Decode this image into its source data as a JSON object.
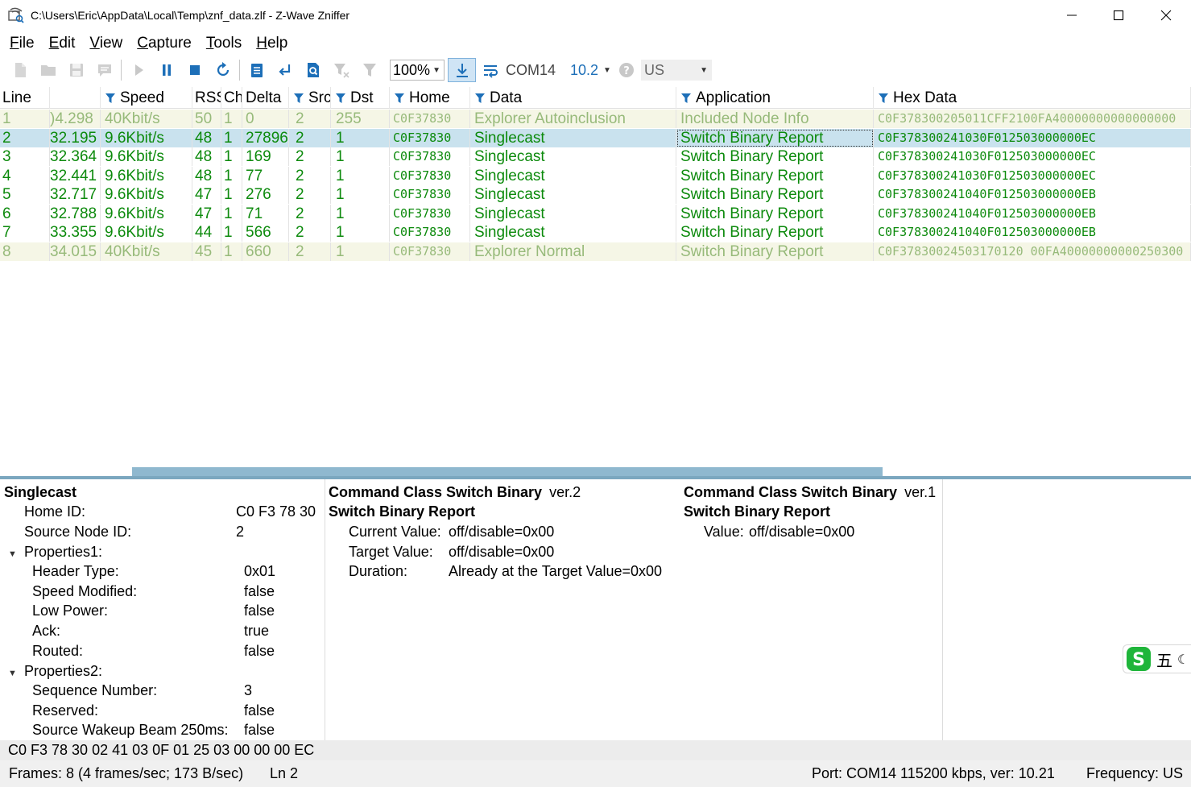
{
  "window": {
    "title": "C:\\Users\\Eric\\AppData\\Local\\Temp\\znf_data.zlf - Z-Wave Zniffer"
  },
  "menu": [
    {
      "label": "File",
      "mnemonic": "F",
      "rest": "ile"
    },
    {
      "label": "Edit",
      "mnemonic": "E",
      "rest": "dit"
    },
    {
      "label": "View",
      "mnemonic": "V",
      "rest": "iew"
    },
    {
      "label": "Capture",
      "mnemonic": "C",
      "rest": "apture"
    },
    {
      "label": "Tools",
      "mnemonic": "T",
      "rest": "ools"
    },
    {
      "label": "Help",
      "mnemonic": "H",
      "rest": "elp"
    }
  ],
  "toolbar": {
    "zoom_value": "100%",
    "port_label": "COM14",
    "version_value": "10.2",
    "frequency_value": "US",
    "icons": [
      "new-file-icon",
      "open-folder-icon",
      "save-icon",
      "comment-icon",
      "play-icon",
      "pause-icon",
      "stop-icon",
      "refresh-icon",
      "list-icon",
      "return-icon",
      "search-document-icon",
      "clear-filter-icon",
      "filter-icon",
      "download-icon",
      "wrap-icon",
      "help-icon"
    ]
  },
  "grid": {
    "columns": [
      {
        "key": "line",
        "label": "Line",
        "filter": false
      },
      {
        "key": "time",
        "label": "",
        "filter": false
      },
      {
        "key": "speed",
        "label": "Speed",
        "filter": true
      },
      {
        "key": "rssi",
        "label": "RSS",
        "filter": false
      },
      {
        "key": "ch",
        "label": "Ch",
        "filter": false
      },
      {
        "key": "delta",
        "label": "Delta",
        "filter": false
      },
      {
        "key": "src",
        "label": "Src",
        "filter": true
      },
      {
        "key": "dst",
        "label": "Dst",
        "filter": true
      },
      {
        "key": "home",
        "label": "Home",
        "filter": true
      },
      {
        "key": "data",
        "label": "Data",
        "filter": true
      },
      {
        "key": "application",
        "label": "Application",
        "filter": true
      },
      {
        "key": "hex",
        "label": "Hex Data",
        "filter": true
      }
    ],
    "rows": [
      {
        "line": "1",
        "time": ")4.298",
        "speed": "40Kbit/s",
        "rssi": "50",
        "ch": "1",
        "delta": "0",
        "src": "2",
        "dst": "255",
        "home": "C0F37830",
        "data": "Explorer Autoinclusion",
        "application": "Included Node Info",
        "hex": "C0F378300205011CFF2100FA40000000000000000",
        "style": "light"
      },
      {
        "line": "2",
        "time": "32.195",
        "speed": "9.6Kbit/s",
        "rssi": "48",
        "ch": "1",
        "delta": "27896",
        "src": "2",
        "dst": "1",
        "home": "C0F37830",
        "data": "Singlecast",
        "application": "Switch Binary Report",
        "hex": "C0F378300241030F012503000000EC",
        "style": "selected"
      },
      {
        "line": "3",
        "time": "32.364",
        "speed": "9.6Kbit/s",
        "rssi": "48",
        "ch": "1",
        "delta": "169",
        "src": "2",
        "dst": "1",
        "home": "C0F37830",
        "data": "Singlecast",
        "application": "Switch Binary Report",
        "hex": "C0F378300241030F012503000000EC",
        "style": "green"
      },
      {
        "line": "4",
        "time": "32.441",
        "speed": "9.6Kbit/s",
        "rssi": "48",
        "ch": "1",
        "delta": "77",
        "src": "2",
        "dst": "1",
        "home": "C0F37830",
        "data": "Singlecast",
        "application": "Switch Binary Report",
        "hex": "C0F378300241030F012503000000EC",
        "style": "green"
      },
      {
        "line": "5",
        "time": "32.717",
        "speed": "9.6Kbit/s",
        "rssi": "47",
        "ch": "1",
        "delta": "276",
        "src": "2",
        "dst": "1",
        "home": "C0F37830",
        "data": "Singlecast",
        "application": "Switch Binary Report",
        "hex": "C0F378300241040F012503000000EB",
        "style": "green"
      },
      {
        "line": "6",
        "time": "32.788",
        "speed": "9.6Kbit/s",
        "rssi": "47",
        "ch": "1",
        "delta": "71",
        "src": "2",
        "dst": "1",
        "home": "C0F37830",
        "data": "Singlecast",
        "application": "Switch Binary Report",
        "hex": "C0F378300241040F012503000000EB",
        "style": "green"
      },
      {
        "line": "7",
        "time": "33.355",
        "speed": "9.6Kbit/s",
        "rssi": "44",
        "ch": "1",
        "delta": "566",
        "src": "2",
        "dst": "1",
        "home": "C0F37830",
        "data": "Singlecast",
        "application": "Switch Binary Report",
        "hex": "C0F378300241040F012503000000EB",
        "style": "green"
      },
      {
        "line": "8",
        "time": "34.015",
        "speed": "40Kbit/s",
        "rssi": "45",
        "ch": "1",
        "delta": "660",
        "src": "2",
        "dst": "1",
        "home": "C0F37830",
        "data": "Explorer Normal",
        "application": "Switch Binary Report",
        "hex": "C0F37830024503170120 00FA40000000000250300",
        "style": "light"
      }
    ]
  },
  "details": {
    "frame": {
      "title": "Singlecast",
      "home_id_label": "Home ID:",
      "home_id_value": "C0 F3 78 30",
      "source_label": "Source Node ID:",
      "source_value": "2",
      "props1_label": "Properties1:",
      "props1": [
        {
          "label": "Header Type:",
          "value": "0x01"
        },
        {
          "label": "Speed Modified:",
          "value": "false"
        },
        {
          "label": "Low Power:",
          "value": "false"
        },
        {
          "label": "Ack:",
          "value": "true"
        },
        {
          "label": "Routed:",
          "value": "false"
        }
      ],
      "props2_label": "Properties2:",
      "props2": [
        {
          "label": "Sequence Number:",
          "value": "3"
        },
        {
          "label": "Reserved:",
          "value": "false"
        },
        {
          "label": "Source Wakeup Beam 250ms:",
          "value": "false"
        }
      ]
    },
    "cc_v2": {
      "class_name": "Command Class Switch Binary",
      "version": "ver.2",
      "command": "Switch Binary Report",
      "fields": [
        {
          "label": "Current Value:",
          "value": "off/disable=0x00"
        },
        {
          "label": "Target Value:",
          "value": "off/disable=0x00"
        },
        {
          "label": "Duration:",
          "value": "Already at the Target Value=0x00"
        }
      ]
    },
    "cc_v1": {
      "class_name": "Command Class Switch Binary",
      "version": "ver.1",
      "command": "Switch Binary Report",
      "fields": [
        {
          "label": "Value:",
          "value": "off/disable=0x00"
        }
      ]
    }
  },
  "hex_bar": "C0 F3 78 30 02 41 03 0F 01 25 03 00 00 00 EC",
  "status": {
    "frames": "Frames: 8 (4 frames/sec; 173 B/sec)",
    "line": "Ln 2",
    "port": "Port: COM14 115200 kbps, ver: 10.21",
    "frequency": "Frequency: US"
  },
  "ime": {
    "char": "五"
  },
  "colors": {
    "green_text": "#0c8a0c",
    "light_text": "#97ba7a",
    "selected_row": "#c9e2ee",
    "light_row": "#f5f6e6",
    "accent_blue": "#1d6fb8"
  }
}
